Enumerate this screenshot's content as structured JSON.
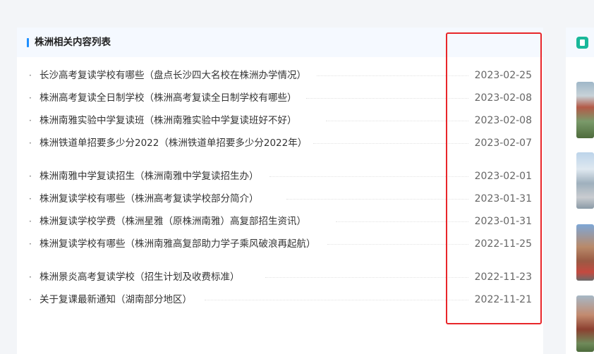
{
  "panel": {
    "title": "株洲相关内容列表",
    "items": [
      {
        "title": "长沙高考复读学校有哪些（盘点长沙四大名校在株洲办学情况）",
        "date": "2023-02-25"
      },
      {
        "title": "株洲高考复读全日制学校（株洲高考复读全日制学校有哪些）",
        "date": "2023-02-08"
      },
      {
        "title": "株洲南雅实验中学复读班（株洲南雅实验中学复读班好不好）",
        "date": "2023-02-08"
      },
      {
        "title": "株洲铁道单招要多少分2022（株洲铁道单招要多少分2022年）",
        "date": "2023-02-07"
      },
      {
        "title": "株洲南雅中学复读招生（株洲南雅中学复读招生办）",
        "date": "2023-02-01"
      },
      {
        "title": "株洲复读学校有哪些（株洲高考复读学校部分简介）",
        "date": "2023-01-31"
      },
      {
        "title": "株洲复读学校学费（株洲星雅（原株洲南雅）高复部招生资讯）",
        "date": "2023-01-31"
      },
      {
        "title": "株洲复读学校有哪些（株洲南雅高复部助力学子乘风破浪再起航）",
        "date": "2022-11-25"
      },
      {
        "title": "株洲景炎高考复读学校（招生计划及收费标准）",
        "date": "2022-11-23"
      },
      {
        "title": "关于复课最新通知（湖南部分地区）",
        "date": "2022-11-21"
      }
    ]
  },
  "colors": {
    "accent": "#1e8fff",
    "highlight": "#e8262a",
    "side_icon": "#19b89a"
  },
  "icons": {
    "side_header": "document-icon"
  }
}
